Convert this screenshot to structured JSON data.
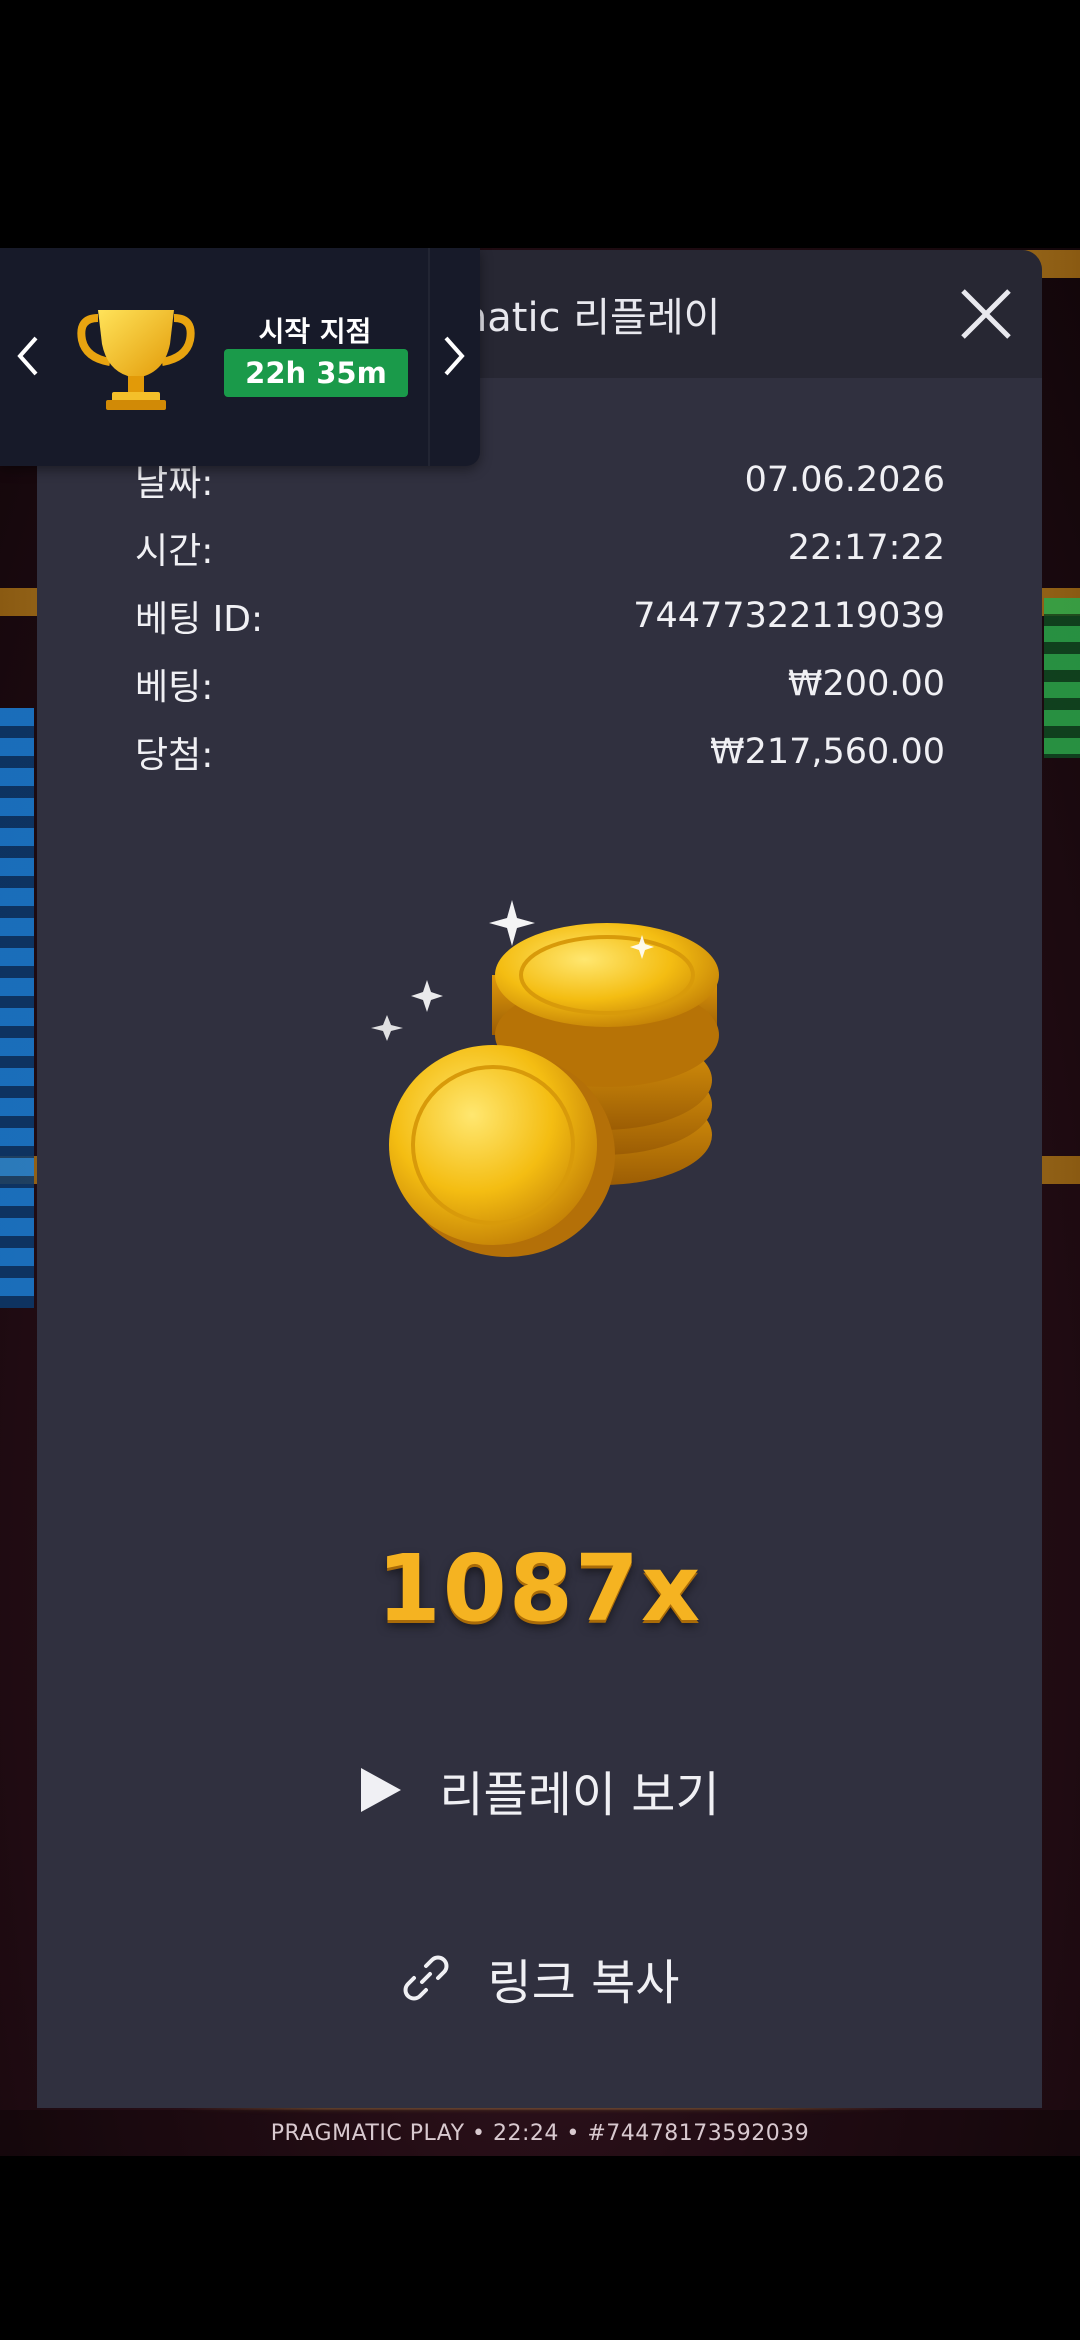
{
  "modal": {
    "title": "Pragmatic 리플레이",
    "rows": [
      {
        "label": "날짜:",
        "value": "07.06.2026"
      },
      {
        "label": "시간:",
        "value": "22:17:22"
      },
      {
        "label": "베팅 ID:",
        "value": "74477322119039"
      },
      {
        "label": "베팅:",
        "value": "₩200.00"
      },
      {
        "label": "당첨:",
        "value": "₩217,560.00"
      }
    ],
    "multiplier": "1087x",
    "replay_label": "리플레이 보기",
    "copy_label": "링크 복사"
  },
  "promo": {
    "label": "시작 지점",
    "timer": "22h 35m"
  },
  "footer": {
    "text": "PRAGMATIC PLAY • 22:24 • #74478173592039"
  },
  "icons": {
    "close": "close-icon",
    "play": "play-icon",
    "link": "link-icon",
    "trophy": "trophy-icon",
    "coins": "gold-coins-icon"
  },
  "colors": {
    "modal_bg": "#30303f",
    "header_bg": "#272733",
    "multiplier": "#f5b321",
    "timer_bg": "#1a9a4a"
  }
}
